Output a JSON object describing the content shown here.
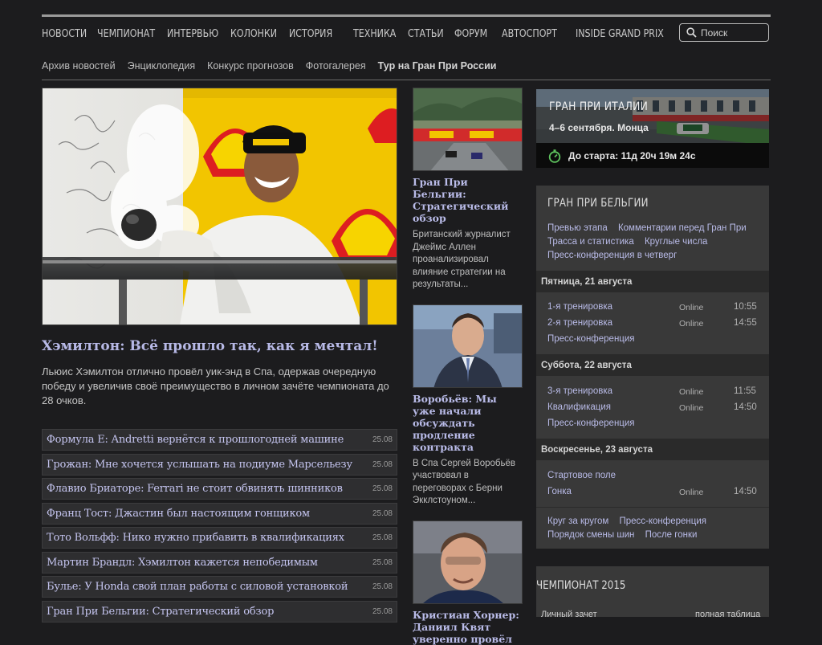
{
  "nav": {
    "items": [
      "НОВОСТИ",
      "ЧЕМПИОНАТ",
      "ИНТЕРВЬЮ",
      "КОЛОНКИ",
      "ИСТОРИЯ",
      "ТЕХНИКА",
      "СТАТЬИ",
      "ФОРУМ",
      "АВТОСПОРТ",
      "INSIDE GRAND PRIX"
    ],
    "search_placeholder": "Поиск"
  },
  "subnav": {
    "items": [
      "Архив новостей",
      "Энциклопедия",
      "Конкурс прогнозов",
      "Фотогалерея",
      "Тур на Гран При России"
    ]
  },
  "hero": {
    "title": "Хэмилтон: Всё прошло так, как я мечтал!",
    "lead": "Льюис Хэмилтон отлично провёл уик-энд в Спа, одержав очередную победу и увеличив своё преимущество в личном зачёте чемпионата до 28 очков."
  },
  "news": [
    {
      "title": "Формула E: Andretti вернётся к прошлогодней машине",
      "date": "25.08"
    },
    {
      "title": "Грожан: Мне хочется услышать на подиуме Марсельезу",
      "date": "25.08"
    },
    {
      "title": "Флавио Бриаторе: Ferrari не стоит обвинять шинников",
      "date": "25.08"
    },
    {
      "title": "Франц Тост: Джастин был настоящим гонщиком",
      "date": "25.08"
    },
    {
      "title": "Тото Вольфф: Нико нужно прибавить в квалификациях",
      "date": "25.08"
    },
    {
      "title": "Мартин Брандл: Хэмилтон кажется непобедимым",
      "date": "25.08"
    },
    {
      "title": "Булье: У Honda свой план работы с силовой установкой",
      "date": "25.08"
    },
    {
      "title": "Гран При Бельгии: Стратегический обзор",
      "date": "25.08"
    }
  ],
  "middle": [
    {
      "title": "Гран При Бельгии: Стратегический обзор",
      "text": "Британский журналист Джеймс Аллен проанализировал влияние стратегии на результаты..."
    },
    {
      "title": "Воробьёв: Мы уже начали обсуждать продление контракта",
      "text": "В Спа Сергей Воробьёв участвовал в переговорах с Берни Экклстоуном..."
    },
    {
      "title": "Кристиан Хорнер: Даниил Квят уверенно провёл",
      "text": ""
    }
  ],
  "next_gp": {
    "title": "ГРАН ПРИ ИТАЛИИ",
    "dates": "4–6 сентября. Монца",
    "countdown": "До старта: 11д 20ч 19м 24с"
  },
  "gp_panel": {
    "title": "ГРАН ПРИ БЕЛЬГИИ",
    "links": [
      "Превью этапа",
      "Комментарии перед Гран При",
      "Трасса и статистика",
      "Круглые числа",
      "Пресс-конференция в четверг"
    ],
    "days": [
      {
        "label": "Пятница, 21 августа",
        "sessions": [
          {
            "name": "1-я тренировка",
            "status": "Online",
            "time": "10:55"
          },
          {
            "name": "2-я тренировка",
            "status": "Online",
            "time": "14:55"
          },
          {
            "name": "Пресс-конференция",
            "status": "",
            "time": ""
          }
        ]
      },
      {
        "label": "Суббота, 22 августа",
        "sessions": [
          {
            "name": "3-я тренировка",
            "status": "Online",
            "time": "11:55"
          },
          {
            "name": "Квалификация",
            "status": "Online",
            "time": "14:50"
          },
          {
            "name": "Пресс-конференция",
            "status": "",
            "time": ""
          }
        ]
      },
      {
        "label": "Воскресенье, 23 августа",
        "sessions": [
          {
            "name": "Стартовое поле",
            "status": "",
            "time": ""
          },
          {
            "name": "Гонка",
            "status": "Online",
            "time": "14:50"
          }
        ]
      }
    ],
    "bottom_links": [
      "Круг за кругом",
      "Пресс-конференция",
      "Порядок смены шин",
      "После гонки"
    ]
  },
  "championship": {
    "title": "ЧЕМПИОНАТ 2015",
    "sub_left": "Личный зачет",
    "sub_right": "полная таблица"
  }
}
